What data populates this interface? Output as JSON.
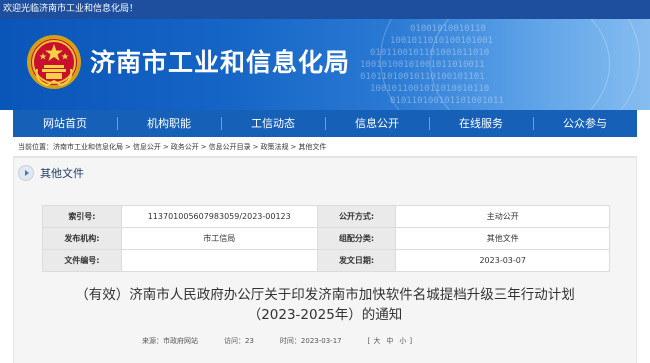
{
  "topbar": {
    "welcome": "欢迎光临济南市工业和信息化局！"
  },
  "header": {
    "site_title": "济南市工业和信息化局",
    "emblem_icon": "national-emblem-icon",
    "accent": "#1660b8"
  },
  "nav": [
    {
      "label": "网站首页"
    },
    {
      "label": "机构职能"
    },
    {
      "label": "工信动态"
    },
    {
      "label": "信息公开"
    },
    {
      "label": "在线服务"
    },
    {
      "label": "公众参与"
    }
  ],
  "breadcrumb": {
    "prefix": "当前位置：",
    "items": [
      "济南市工业和信息化局",
      "信息公开",
      "政务公开",
      "信息公开目录",
      "政策法规",
      "其他文件"
    ],
    "separator": ">"
  },
  "category": {
    "label": "其他文件",
    "icon": "arrow-circle-icon"
  },
  "info_table": {
    "index_label": "索引号:",
    "index_value": "113701005607983059/2023-00123",
    "open_mode_label": "公开方式:",
    "open_mode_value": "主动公开",
    "issuer_label": "发布机构:",
    "issuer_value": "市工信局",
    "category_label": "组配分类:",
    "category_value": "其他文件",
    "doc_no_label": "文件编号:",
    "doc_no_value": "",
    "date_label": "发文日期:",
    "date_value": "2023-03-07"
  },
  "document": {
    "title_line1": "（有效）济南市人民政府办公厅关于印发济南市加快软件名城提档升级三年行动计划",
    "title_line2": "（2023-2025年）的通知"
  },
  "meta": {
    "source_label": "来源：",
    "source_value": "市政府网站",
    "visits_label": "访问：",
    "visits_value": "23",
    "date_label": "时间：",
    "date_value": "2023-03-17",
    "font_open": "[",
    "font_large": "大",
    "font_medium": "中",
    "font_small": "小",
    "font_close": "]"
  }
}
